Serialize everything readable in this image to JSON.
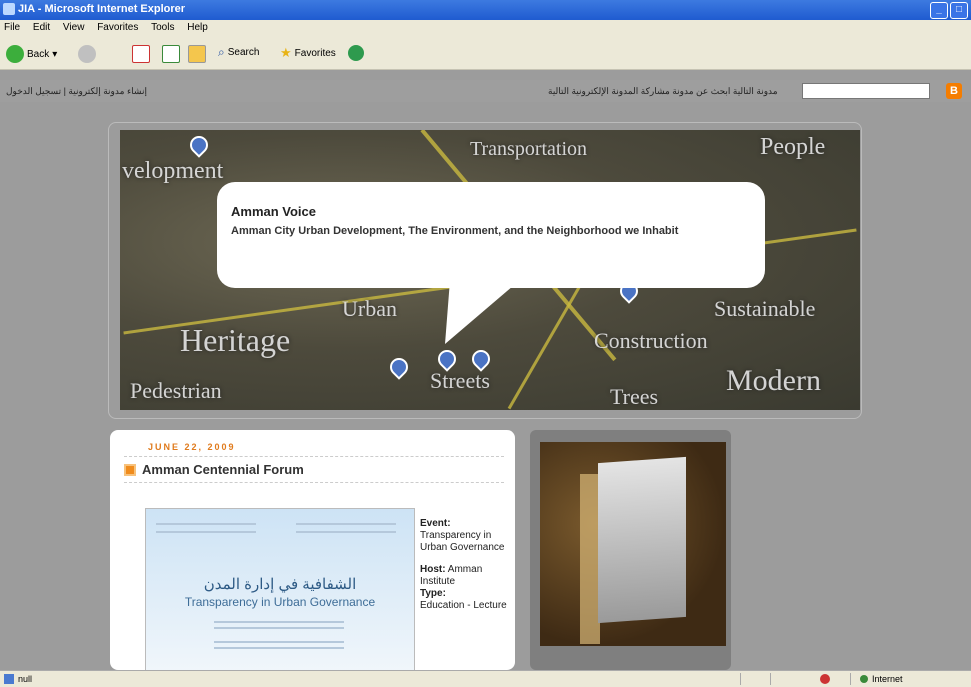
{
  "window": {
    "title": "JIA - Microsoft Internet Explorer"
  },
  "menu": [
    "File",
    "Edit",
    "View",
    "Favorites",
    "Tools",
    "Help"
  ],
  "toolbar": {
    "back_label": "Back",
    "search_label": "Search",
    "favorites_label": "Favorites"
  },
  "blogbar": {
    "right_links": "مدونة التالية   ابحث عن مدونة   مشاركة   المدونة الإلكترونية التالية",
    "left_links": "إنشاء مدونة إلكترونية | تسجيل الدخول"
  },
  "header": {
    "overlay_words": [
      "velopment",
      "Transportation",
      "People",
      "Urban",
      "Sustainable",
      "Heritage",
      "Construction",
      "Pedestrian",
      "Streets",
      "Trees",
      "Modern"
    ],
    "bubble_title": "Amman Voice",
    "bubble_text": "Amman City Urban Development, The Environment, and the Neighborhood we Inhabit"
  },
  "post": {
    "date": "JUNE 22, 2009",
    "title": "Amman Centennial Forum",
    "flyer_arabic": "الشفافية في إدارة المدن",
    "flyer_english": "Transparency in Urban Governance",
    "event_label": "Event:",
    "event_value": "Transparency in Urban Governance",
    "host_label": "Host:",
    "host_value": "Amman Institute",
    "type_label": "Type:",
    "type_value": "Education - Lecture"
  },
  "status": {
    "left": "null",
    "zone": "Internet"
  }
}
